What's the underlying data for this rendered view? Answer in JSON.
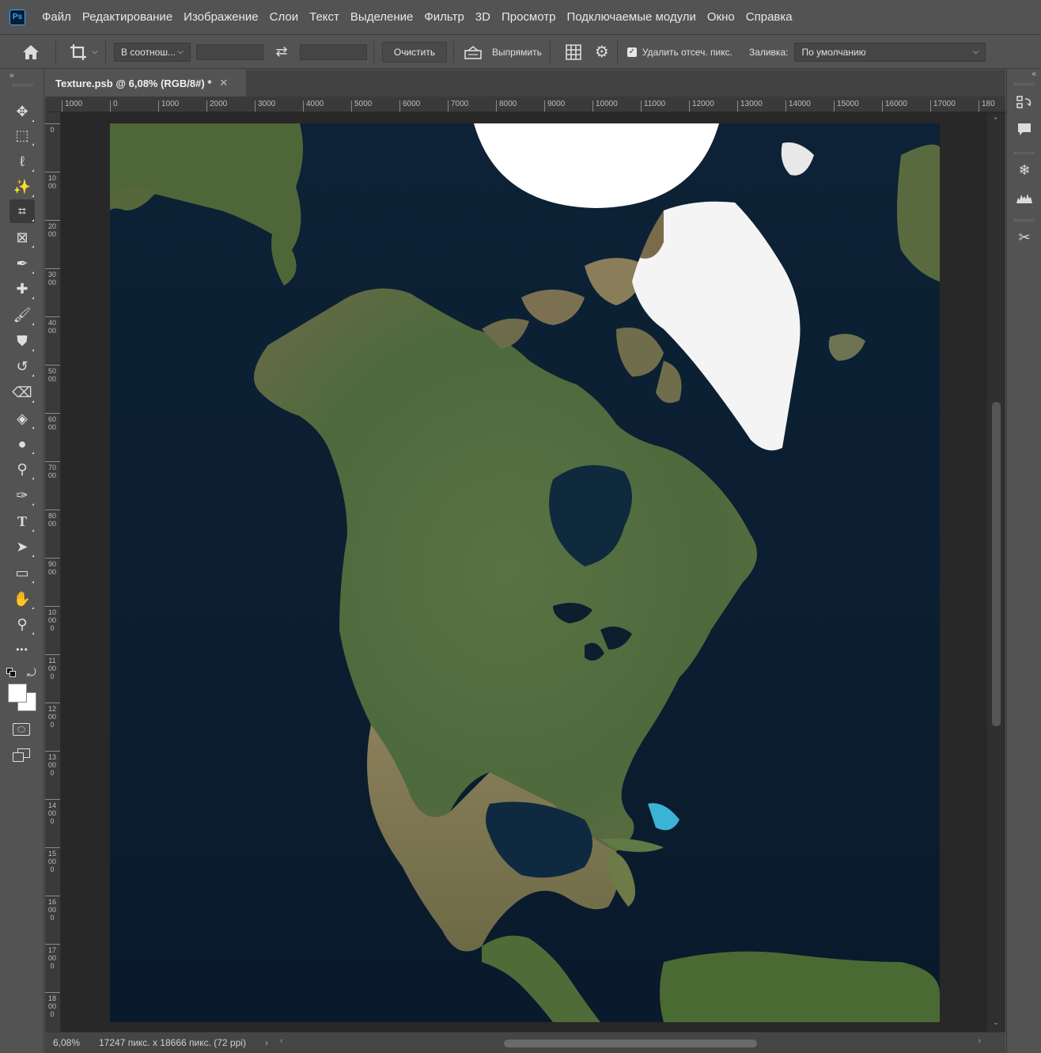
{
  "app": {
    "logo_text": "Ps"
  },
  "menu": [
    "Файл",
    "Редактирование",
    "Изображение",
    "Слои",
    "Текст",
    "Выделение",
    "Фильтр",
    "3D",
    "Просмотр",
    "Подключаемые модули",
    "Окно",
    "Справка"
  ],
  "options": {
    "ratio_select": "В соотнош...",
    "clear_button": "Очистить",
    "straighten_label": "Выпрямить",
    "delete_cropped_label": "Удалить отсеч. пикс.",
    "delete_cropped_checked": true,
    "fill_label": "Заливка:",
    "fill_select": "По умолчанию"
  },
  "tools": [
    {
      "name": "move-tool",
      "glyph": "✥"
    },
    {
      "name": "marquee-tool",
      "glyph": "⬚"
    },
    {
      "name": "lasso-tool",
      "glyph": "ℓ"
    },
    {
      "name": "magic-wand-tool",
      "glyph": "✨"
    },
    {
      "name": "crop-tool",
      "glyph": "⌗"
    },
    {
      "name": "frame-tool",
      "glyph": "⊠"
    },
    {
      "name": "eyedropper-tool",
      "glyph": "✒"
    },
    {
      "name": "healing-brush-tool",
      "glyph": "✚"
    },
    {
      "name": "brush-tool",
      "glyph": "🖌"
    },
    {
      "name": "clone-stamp-tool",
      "glyph": "⛊"
    },
    {
      "name": "history-brush-tool",
      "glyph": "↺"
    },
    {
      "name": "eraser-tool",
      "glyph": "⌫"
    },
    {
      "name": "paint-bucket-tool",
      "glyph": "◈"
    },
    {
      "name": "blur-tool",
      "glyph": "●"
    },
    {
      "name": "dodge-tool",
      "glyph": "⚲"
    },
    {
      "name": "pen-tool",
      "glyph": "✑"
    },
    {
      "name": "type-tool",
      "glyph": "T"
    },
    {
      "name": "path-selection-tool",
      "glyph": "➤"
    },
    {
      "name": "rectangle-tool",
      "glyph": "▭"
    },
    {
      "name": "hand-tool",
      "glyph": "✋"
    },
    {
      "name": "zoom-tool",
      "glyph": "⚲"
    },
    {
      "name": "more-tools",
      "glyph": "•••"
    }
  ],
  "document": {
    "tab_title": "Texture.psb @ 6,08% (RGB/8#) *",
    "zoom": "6,08%",
    "info": "17247 пикс. x 18666 пикс. (72 ppi)"
  },
  "ruler_h": [
    "1000",
    "0",
    "1000",
    "2000",
    "3000",
    "4000",
    "5000",
    "6000",
    "7000",
    "8000",
    "9000",
    "10000",
    "11000",
    "12000",
    "13000",
    "14000",
    "15000",
    "16000",
    "17000",
    "180"
  ],
  "ruler_v": [
    "0",
    "1000",
    "2000",
    "3000",
    "4000",
    "5000",
    "6000",
    "7000",
    "8000",
    "9000",
    "10000",
    "11000",
    "12000",
    "13000",
    "14000",
    "15000",
    "16000",
    "17000",
    "18000"
  ]
}
